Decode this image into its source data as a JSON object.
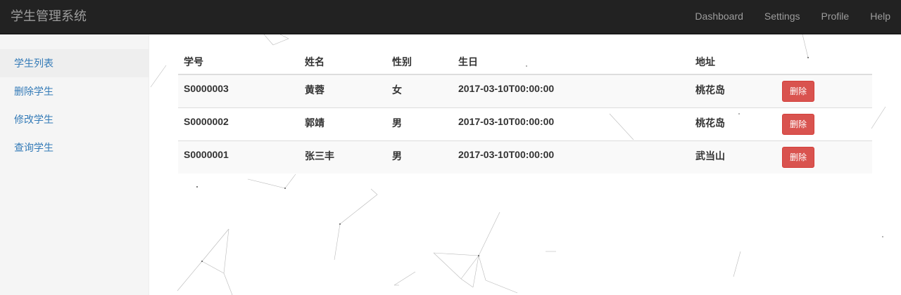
{
  "navbar": {
    "brand": "学生管理系统",
    "links": [
      "Dashboard",
      "Settings",
      "Profile",
      "Help"
    ]
  },
  "sidebar": {
    "items": [
      {
        "label": "学生列表",
        "active": true
      },
      {
        "label": "删除学生",
        "active": false
      },
      {
        "label": "修改学生",
        "active": false
      },
      {
        "label": "查询学生",
        "active": false
      }
    ]
  },
  "table": {
    "headers": [
      "学号",
      "姓名",
      "性别",
      "生日",
      "地址",
      ""
    ],
    "rows": [
      {
        "id": "S0000003",
        "name": "黄蓉",
        "gender": "女",
        "birthday": "2017-03-10T00:00:00",
        "address": "桃花岛",
        "action": "删除"
      },
      {
        "id": "S0000002",
        "name": "郭靖",
        "gender": "男",
        "birthday": "2017-03-10T00:00:00",
        "address": "桃花岛",
        "action": "删除"
      },
      {
        "id": "S0000001",
        "name": "张三丰",
        "gender": "男",
        "birthday": "2017-03-10T00:00:00",
        "address": "武当山",
        "action": "删除"
      }
    ]
  },
  "colors": {
    "navbar_bg": "#222222",
    "nav_text": "#9d9d9d",
    "link": "#337ab7",
    "danger": "#d9534f",
    "sidebar_bg": "#f5f5f5"
  }
}
